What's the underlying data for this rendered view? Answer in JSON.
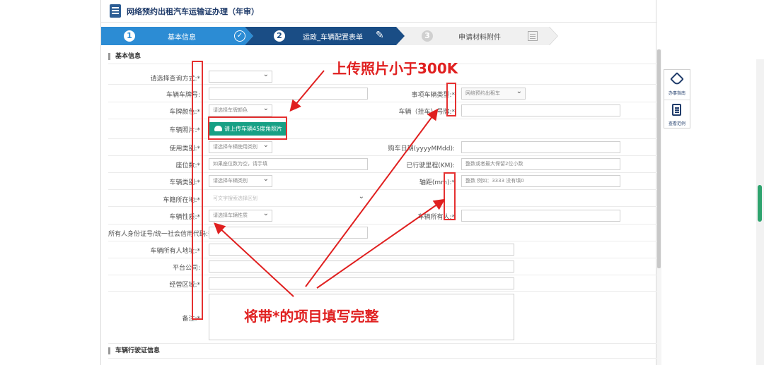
{
  "page": {
    "title": "网络预约出租汽车运输证办理（年审）"
  },
  "steps": [
    {
      "num": "1",
      "label": "基本信息"
    },
    {
      "num": "2",
      "label": "运政_车辆配置表单"
    },
    {
      "num": "3",
      "label": "申请材料附件"
    }
  ],
  "sections": {
    "basic": "基本信息",
    "license": "车辆行驶证信息"
  },
  "form": {
    "query_method": {
      "label": "请选择查询方式:*",
      "value": ""
    },
    "plate_number": {
      "label": "车辆车牌号:",
      "value": ""
    },
    "item_vehicle_type": {
      "label": "事项车辆类型:*",
      "value": "网络预约出租车"
    },
    "plate_color": {
      "label": "车牌颜色:*",
      "placeholder": "请选择车牌颜色"
    },
    "vehicle_owner_no": {
      "label": "车辆（挂车）号牌:*",
      "value": ""
    },
    "vehicle_photo": {
      "label": "车辆照片:*",
      "button": "请上传车辆45度角照片"
    },
    "use_type": {
      "label": "使用类别:*",
      "placeholder": "请选择车辆使用类别"
    },
    "register_date": {
      "label": "购车日期(yyyyMMdd):",
      "value": ""
    },
    "seats": {
      "label": "座位数:*",
      "placeholder": "如果座位数为空，请手填"
    },
    "mileage": {
      "label": "已行驶里程(KM):",
      "placeholder": "整数或者最大保留2位小数"
    },
    "vehicle_category": {
      "label": "车辆类别:*",
      "placeholder": "请选择车辆类别"
    },
    "wheelbase": {
      "label": "轴距(mm):*",
      "placeholder": "整数 例如：3333 没有填0"
    },
    "region": {
      "label": "车籍所在地:*",
      "placeholder": "可文字搜索选择区划"
    },
    "vehicle_nature": {
      "label": "车辆性质:*",
      "placeholder": "请选择车辆性质"
    },
    "owner": {
      "label": "车辆所有人:*",
      "value": ""
    },
    "owner_id": {
      "label": "所有人身份证号/统一社会信用代码:*",
      "value": ""
    },
    "owner_address": {
      "label": "车辆所有人地址:*",
      "value": ""
    },
    "platform": {
      "label": "平台公司:",
      "value": ""
    },
    "district": {
      "label": "经营区域:*",
      "value": ""
    },
    "remark": {
      "label": "备注:*",
      "value": ""
    }
  },
  "annotations": {
    "photo_note": "上传照片小于300K",
    "fill_note": "将带*的项目填写完整",
    "color": "#e02020"
  },
  "right_panel": {
    "guide": "办事指南",
    "example": "查看范例"
  },
  "colors": {
    "step_active": "#1a4d85",
    "step_done": "#2c8cd4",
    "upload": "#17a085"
  }
}
